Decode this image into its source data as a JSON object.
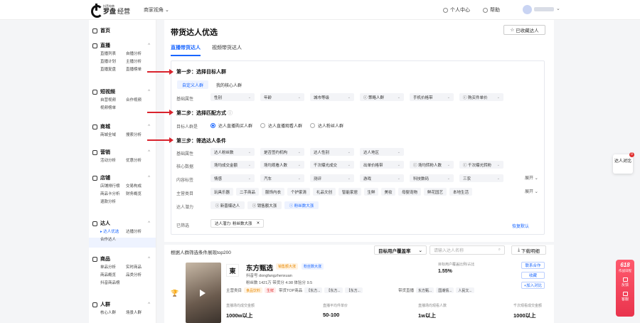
{
  "header": {
    "logo_small": "抖音电商",
    "logo_main": "罗盘",
    "logo_suffix": "经营",
    "view_selector": "商家视角",
    "personal_center": "个人中心",
    "help": "帮助"
  },
  "sidebar": {
    "groups": [
      {
        "title": "首页",
        "icon": "home-icon",
        "items": []
      },
      {
        "title": "直播",
        "icon": "live-icon",
        "items": [
          "直播列表",
          "自播分析",
          "直播计划",
          "主播分析",
          "直播复盘",
          "直播榜单"
        ]
      },
      {
        "title": "短视频",
        "icon": "video-icon",
        "items": [
          "自营视频",
          "合作视频",
          "视频榜单"
        ]
      },
      {
        "title": "商城",
        "icon": "mall-icon",
        "items": [
          "商城全域",
          "搜索分析"
        ]
      },
      {
        "title": "营销",
        "icon": "marketing-icon",
        "items": [
          "活动分析",
          "优惠分析"
        ]
      },
      {
        "title": "店铺",
        "icon": "shop-icon",
        "items": [
          "店铺排行榜",
          "交易构成",
          "商品卡分析",
          "财务概览",
          "退款分析"
        ]
      },
      {
        "title": "达人",
        "icon": "talent-icon",
        "items": [
          "达人优选",
          "达播分析",
          "合作达人"
        ]
      },
      {
        "title": "商品",
        "icon": "product-icon",
        "items": [
          "单品分析",
          "实时商品",
          "商品概览",
          "品类分析",
          "抖音商品榜"
        ]
      },
      {
        "title": "人群",
        "icon": "crowd-icon",
        "items": [
          "核心人群",
          "场景人群"
        ]
      }
    ],
    "active_item": "达人优选"
  },
  "page": {
    "title": "带货达人优选",
    "favorites_button": "已收藏达人",
    "tabs": [
      "直播带货达人",
      "视频带货达人"
    ]
  },
  "step1": {
    "title": "第一步：选择目标人群",
    "subtabs": [
      "自定义人群",
      "我的核心人群"
    ],
    "row_label": "基础属性",
    "chips": [
      "性别",
      "年龄",
      "城市等级",
      "策略人群",
      "手机价格带",
      "购买件单价"
    ]
  },
  "step2": {
    "title": "第二步：选择匹配方式",
    "row_label": "目标人群是",
    "options": [
      "达人直播购买人群",
      "达人直播观看人群",
      "达人粉丝人群"
    ]
  },
  "step3": {
    "title": "第三步：筛选达人条件",
    "basic_label": "基础属性",
    "basic_chips": [
      "达人粉丝数",
      "是否签约机构",
      "达人性别",
      "达人地区"
    ],
    "core_label": "核心数据",
    "core_chips": [
      "场均成交金额",
      "场均观看人数",
      "千次曝光成交",
      "出单价格带",
      "场均转粉人数",
      "千次曝光转粉"
    ],
    "content_label": "内容标签",
    "content_tags": [
      "情感",
      "汽车",
      "测评",
      "游戏",
      "科技数码",
      "三农"
    ],
    "category_label": "主营类目",
    "category_tags": [
      "玩具乐器",
      "二手商品",
      "服饰内衣",
      "个护家清",
      "礼品文创",
      "智能家居",
      "生鲜",
      "美妆",
      "母婴宠物",
      "鲜花园艺",
      "本地生活"
    ],
    "potential_label": "达人潜力",
    "potential_tags": [
      "新晋爆达人",
      "销售额大涨",
      "粉丝数大涨"
    ],
    "expand": "展开"
  },
  "selected": {
    "label": "已筛选",
    "chip": "达人潜力: 粉丝数大涨",
    "reset": "恢复默认"
  },
  "results": {
    "title": "根据人群筛选条件展现top200",
    "sort_select": "目标用户覆盖率",
    "search_placeholder": "请输入达人名称",
    "download": "下载明细",
    "item": {
      "name": "东方甄选",
      "badges": [
        "销售额大涨",
        "粉丝数大涨"
      ],
      "handle": "抖音号 dongfangzhenxuan",
      "stats_line": "粉丝数 1421万  带货分 4.98  体验分 9.5",
      "main_category_label": "主营类目",
      "main_categories": [
        "食品饮料",
        "生鲜"
      ],
      "top_products_label": "带货TOP商品",
      "top_products": [
        "【东方...",
        "【东方...",
        "【东方..."
      ],
      "content_label": "带货直播",
      "content_tags": [
        "东方甄...",
        "国潮情...",
        "人民文..."
      ],
      "coverage_label": "目标用户覆盖比例/占比",
      "coverage_value": "1.55%",
      "metrics": [
        {
          "label": "直播场均成交金额",
          "value": "1000w以上"
        },
        {
          "label": "直播平均件单价",
          "value": "50-100"
        },
        {
          "label": "直播场均观看人数",
          "value": "1w以上"
        },
        {
          "label": "千次观看成交金额",
          "value": "1000以上"
        }
      ],
      "actions": [
        "联系合作",
        "收藏",
        "+加入对比"
      ]
    }
  },
  "float": {
    "compare": "达人对比",
    "compare_badge": "0",
    "promo_top": "618",
    "promo_sub": "作战日程",
    "feedback": "反馈",
    "favorites": "客服"
  }
}
